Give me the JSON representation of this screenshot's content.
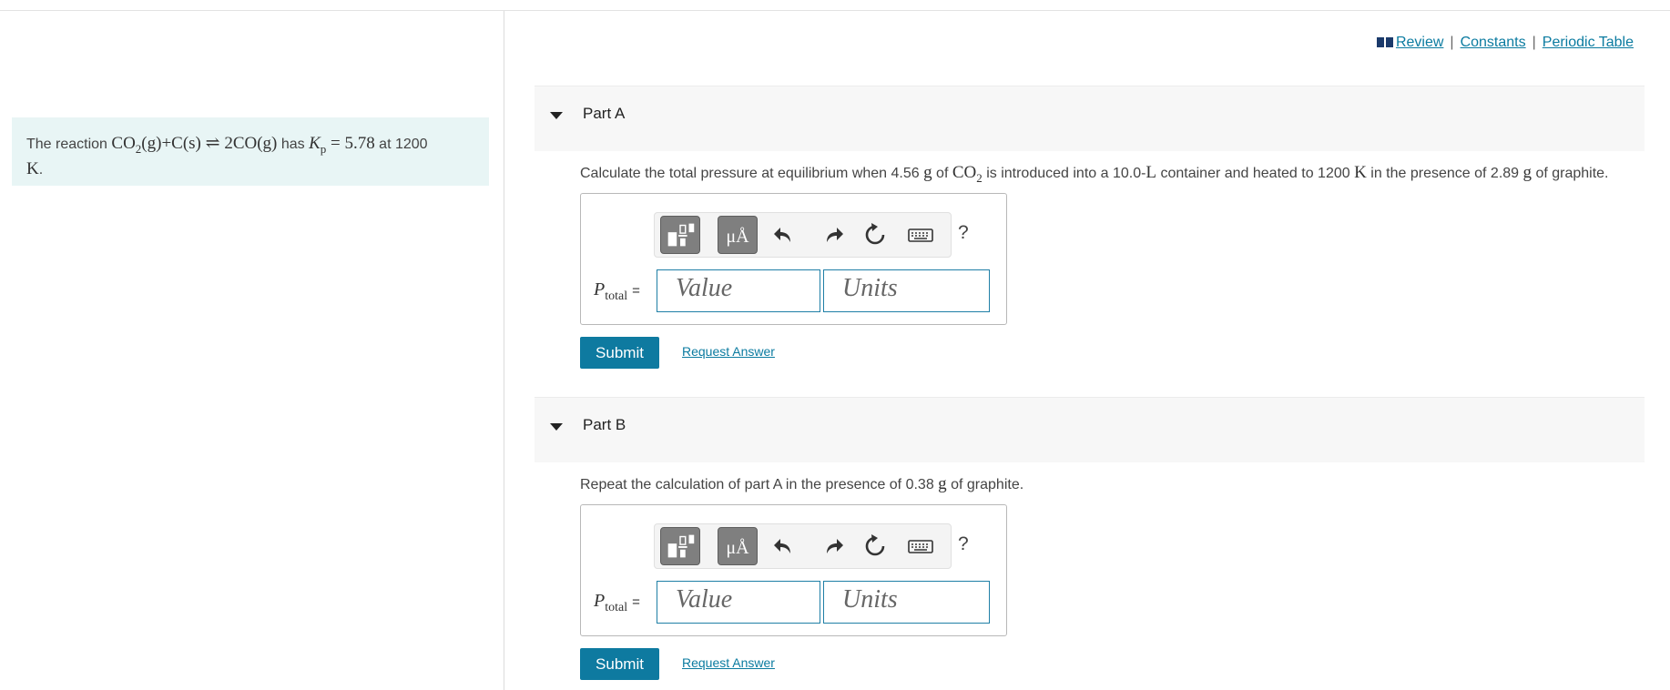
{
  "toplinks": {
    "review": "Review",
    "sep1": "|",
    "constants": "Constants",
    "sep2": "|",
    "periodic": "Periodic Table"
  },
  "intro": {
    "prefix": "The reaction ",
    "reaction_lhs": "CO",
    "reaction_lhs_sub": "2",
    "reaction_lhs_rest": "(g)+C(s)",
    "arrow": "⇌",
    "reaction_rhs": "2CO(g)",
    "has": " has ",
    "kp_symbol": "K",
    "kp_sub": "p",
    "kp_value": "= 5.78",
    "at": " at 1200",
    "unit": "K",
    "period": "."
  },
  "parts": [
    {
      "title": "Part A",
      "question": {
        "a": "Calculate the total pressure at equilibrium when 4.56 ",
        "g1": "g",
        "b": " of ",
        "co": "CO",
        "co_sub": "2",
        "c": " is introduced into a 10.0-",
        "L": "L",
        "d": " container and heated to 1200 ",
        "K": "K",
        "e": " in the presence of 2.89 ",
        "g2": "g",
        "f": " of graphite."
      },
      "var_symbol": "P",
      "var_sub": "total",
      "var_eq": "=",
      "value_placeholder": "Value",
      "units_placeholder": "Units",
      "submit": "Submit",
      "request": "Request Answer"
    },
    {
      "title": "Part B",
      "question": {
        "a": "Repeat the calculation of part A in the presence of 0.38 ",
        "g1": "g",
        "b": " of graphite."
      },
      "var_symbol": "P",
      "var_sub": "total",
      "var_eq": "=",
      "value_placeholder": "Value",
      "units_placeholder": "Units",
      "submit": "Submit",
      "request": "Request Answer"
    }
  ],
  "toolbar": {
    "mu_label": "μÅ",
    "help": "?"
  },
  "colors": {
    "accent": "#0e7aa0",
    "link": "#0b7ba0",
    "intro_bg": "#e8f5f5"
  }
}
